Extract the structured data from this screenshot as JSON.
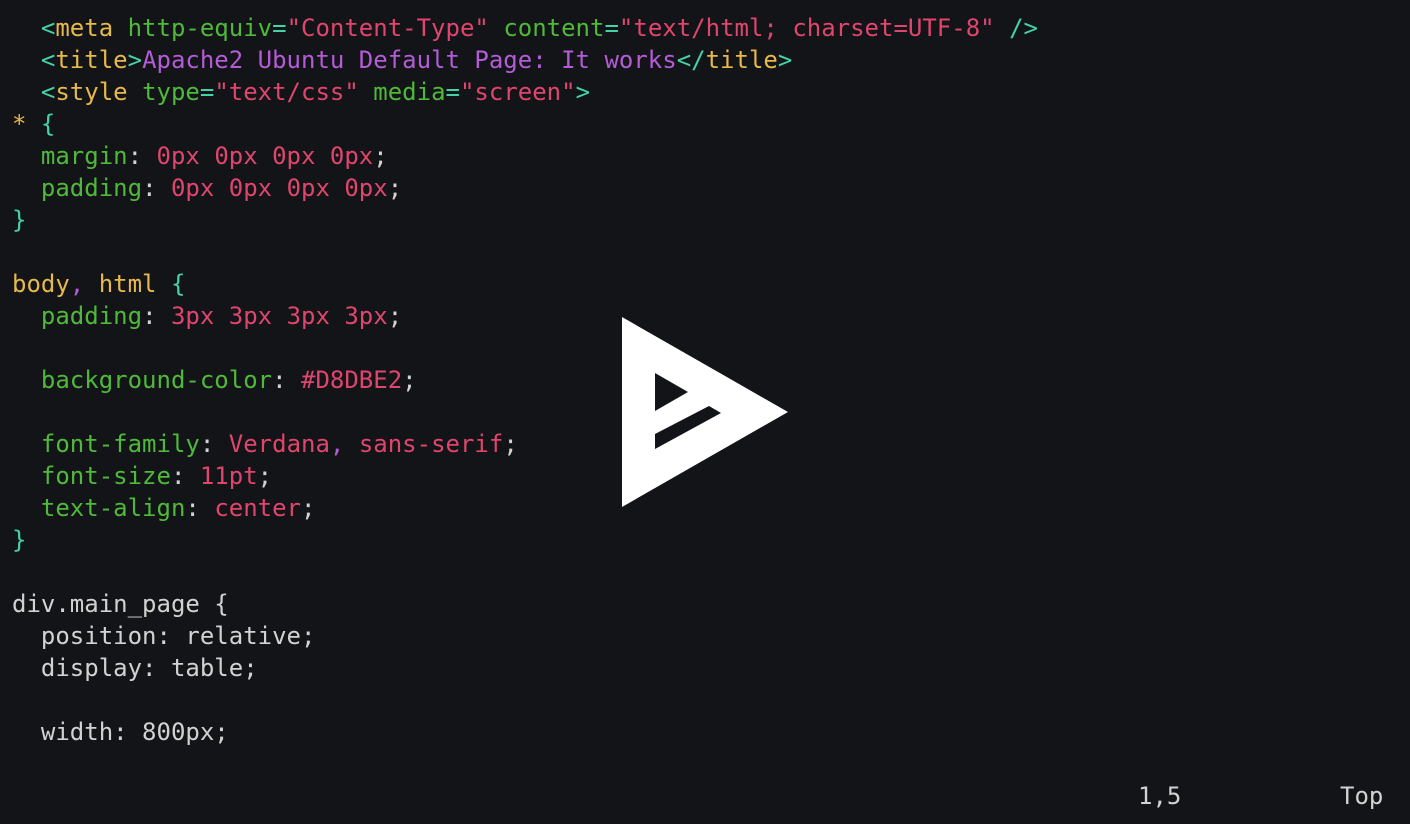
{
  "colors": {
    "background": "#121417",
    "default": "#d2d2d2",
    "tag_bracket": "#44d3a4",
    "tag_name": "#e7b84a",
    "attribute": "#4fb93a",
    "string": "#e0456e",
    "title_text": "#b55bd8",
    "property": "#4fb93a",
    "value": "#e0456e",
    "selector": "#e7b84a",
    "brace": "#44d3a4",
    "punct": "#b55bd8"
  },
  "editor": {
    "lines": [
      {
        "tokens": [
          {
            "t": "  ",
            "c": "default"
          },
          {
            "t": "<",
            "c": "tag_bracket"
          },
          {
            "t": "meta",
            "c": "tag_name"
          },
          {
            "t": " ",
            "c": "default"
          },
          {
            "t": "http-equiv",
            "c": "attribute"
          },
          {
            "t": "=",
            "c": "tag_bracket"
          },
          {
            "t": "\"Content-Type\"",
            "c": "string"
          },
          {
            "t": " ",
            "c": "default"
          },
          {
            "t": "content",
            "c": "attribute"
          },
          {
            "t": "=",
            "c": "tag_bracket"
          },
          {
            "t": "\"text/html; charset=UTF-8\"",
            "c": "string"
          },
          {
            "t": " ",
            "c": "default"
          },
          {
            "t": "/>",
            "c": "tag_bracket"
          }
        ]
      },
      {
        "tokens": [
          {
            "t": "  ",
            "c": "default"
          },
          {
            "t": "<",
            "c": "tag_bracket"
          },
          {
            "t": "title",
            "c": "tag_name"
          },
          {
            "t": ">",
            "c": "tag_bracket"
          },
          {
            "t": "Apache2 Ubuntu Default Page: It works",
            "c": "title_text"
          },
          {
            "t": "</",
            "c": "tag_bracket"
          },
          {
            "t": "title",
            "c": "tag_name"
          },
          {
            "t": ">",
            "c": "tag_bracket"
          }
        ]
      },
      {
        "tokens": [
          {
            "t": "  ",
            "c": "default"
          },
          {
            "t": "<",
            "c": "tag_bracket"
          },
          {
            "t": "style",
            "c": "tag_name"
          },
          {
            "t": " ",
            "c": "default"
          },
          {
            "t": "type",
            "c": "attribute"
          },
          {
            "t": "=",
            "c": "tag_bracket"
          },
          {
            "t": "\"text/css\"",
            "c": "string"
          },
          {
            "t": " ",
            "c": "default"
          },
          {
            "t": "media",
            "c": "attribute"
          },
          {
            "t": "=",
            "c": "tag_bracket"
          },
          {
            "t": "\"screen\"",
            "c": "string"
          },
          {
            "t": ">",
            "c": "tag_bracket"
          }
        ]
      },
      {
        "tokens": [
          {
            "t": "* ",
            "c": "selector"
          },
          {
            "t": "{",
            "c": "brace"
          }
        ]
      },
      {
        "tokens": [
          {
            "t": "  ",
            "c": "default"
          },
          {
            "t": "margin",
            "c": "property"
          },
          {
            "t": ": ",
            "c": "default"
          },
          {
            "t": "0px 0px 0px 0px",
            "c": "value"
          },
          {
            "t": ";",
            "c": "default"
          }
        ]
      },
      {
        "tokens": [
          {
            "t": "  ",
            "c": "default"
          },
          {
            "t": "padding",
            "c": "property"
          },
          {
            "t": ": ",
            "c": "default"
          },
          {
            "t": "0px 0px 0px 0px",
            "c": "value"
          },
          {
            "t": ";",
            "c": "default"
          }
        ]
      },
      {
        "tokens": [
          {
            "t": "}",
            "c": "brace"
          }
        ]
      },
      {
        "tokens": []
      },
      {
        "tokens": [
          {
            "t": "body",
            "c": "selector"
          },
          {
            "t": ",",
            "c": "punct"
          },
          {
            "t": " ",
            "c": "default"
          },
          {
            "t": "html",
            "c": "selector"
          },
          {
            "t": " ",
            "c": "default"
          },
          {
            "t": "{",
            "c": "brace"
          }
        ]
      },
      {
        "tokens": [
          {
            "t": "  ",
            "c": "default"
          },
          {
            "t": "padding",
            "c": "property"
          },
          {
            "t": ": ",
            "c": "default"
          },
          {
            "t": "3px 3px 3px 3px",
            "c": "value"
          },
          {
            "t": ";",
            "c": "default"
          }
        ]
      },
      {
        "tokens": []
      },
      {
        "tokens": [
          {
            "t": "  ",
            "c": "default"
          },
          {
            "t": "background-color",
            "c": "property"
          },
          {
            "t": ": ",
            "c": "default"
          },
          {
            "t": "#D8DBE2",
            "c": "value"
          },
          {
            "t": ";",
            "c": "default"
          }
        ]
      },
      {
        "tokens": []
      },
      {
        "tokens": [
          {
            "t": "  ",
            "c": "default"
          },
          {
            "t": "font-family",
            "c": "property"
          },
          {
            "t": ": ",
            "c": "default"
          },
          {
            "t": "Verdana",
            "c": "value"
          },
          {
            "t": ",",
            "c": "punct"
          },
          {
            "t": " ",
            "c": "default"
          },
          {
            "t": "sans-serif",
            "c": "value"
          },
          {
            "t": ";",
            "c": "default"
          }
        ]
      },
      {
        "tokens": [
          {
            "t": "  ",
            "c": "default"
          },
          {
            "t": "font-size",
            "c": "property"
          },
          {
            "t": ": ",
            "c": "default"
          },
          {
            "t": "11pt",
            "c": "value"
          },
          {
            "t": ";",
            "c": "default"
          }
        ]
      },
      {
        "tokens": [
          {
            "t": "  ",
            "c": "default"
          },
          {
            "t": "text-align",
            "c": "property"
          },
          {
            "t": ": ",
            "c": "default"
          },
          {
            "t": "center",
            "c": "value"
          },
          {
            "t": ";",
            "c": "default"
          }
        ]
      },
      {
        "tokens": [
          {
            "t": "}",
            "c": "brace"
          }
        ]
      },
      {
        "tokens": []
      },
      {
        "tokens": [
          {
            "t": "div.main_page {",
            "c": "default"
          }
        ]
      },
      {
        "tokens": [
          {
            "t": "  position: relative;",
            "c": "default"
          }
        ]
      },
      {
        "tokens": [
          {
            "t": "  display: table;",
            "c": "default"
          }
        ]
      },
      {
        "tokens": []
      },
      {
        "tokens": [
          {
            "t": "  width: 800px;",
            "c": "default"
          }
        ]
      }
    ]
  },
  "status_bar": {
    "cursor_position": "1,5",
    "scroll_position": "Top"
  },
  "overlay": {
    "icon": "asciinema-play-icon",
    "fill": "#ffffff"
  }
}
